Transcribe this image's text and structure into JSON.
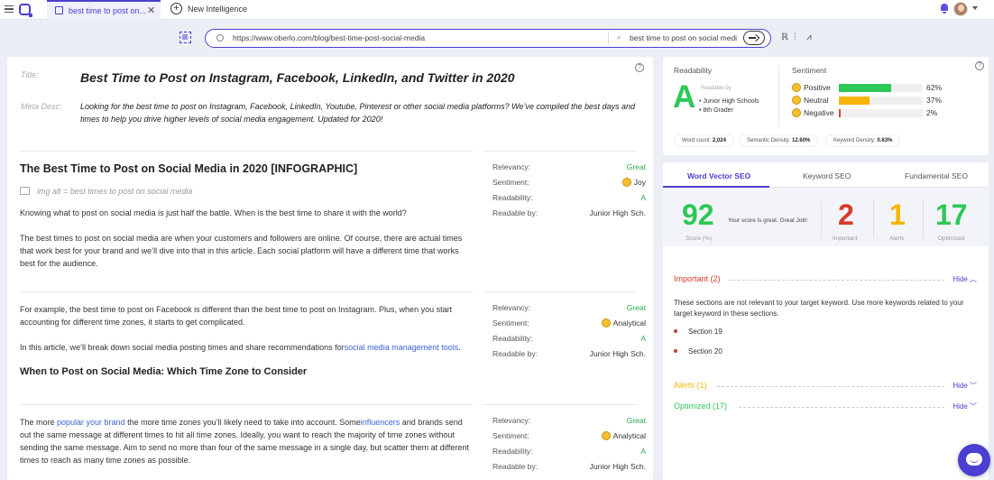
{
  "tabs": {
    "active_tab_label": "best time to post on...",
    "new_tab_label": "New Intelligence"
  },
  "urlbar": {
    "url": "https://www.oberlo.com/blog/best-time-post-social-media",
    "keyword": "best time to post on social medi"
  },
  "page": {
    "title_label": "Title:",
    "title": "Best Time to Post on Instagram, Facebook, LinkedIn, and Twitter in 2020",
    "meta_label": "Meta Desc:",
    "meta": "Looking for the best time to post on Instagram, Facebook, LinkedIn, Youtube, Pinterest or other social media platforms? We’ve compiled the best days and times to help you drive higher levels of social media engagement. Updated for 2020!"
  },
  "sections": [
    {
      "heading": "The Best Time to Post on Social Media in 2020 [INFOGRAPHIC]",
      "img_alt": "img alt = best times to post on social media",
      "p1": "Knowing what to post on social media is just half the battle. When is the best time to share it with the world?",
      "p2": "The best times to post on social media are when your customers and followers are online. Of course, there are actual times that work best for your brand and we’ll dive into that in this article. Each social platform will have a different time that works best for the audience.",
      "metrics": {
        "relevancy": "Great",
        "sentiment": "Joy",
        "readability": "A",
        "readable_by": "Junior High Sch."
      }
    },
    {
      "p1": "For example, the best time to post on Facebook is different than the best time to post on Instagram. Plus, when you start accounting for different time zones, it starts to get complicated.",
      "p2_pre": "In this article, we’ll break down social media posting times and share recommendations for",
      "p2_link": "social media management tools",
      "p2_post": ".",
      "heading": "When to Post on Social Media: Which Time Zone to Consider",
      "metrics": {
        "relevancy": "Great",
        "sentiment": "Analytical",
        "readability": "A",
        "readable_by": "Junior High Sch."
      }
    },
    {
      "p_a": "The more ",
      "link1": "popular your brand",
      "p_b": " the more time zones you’ll likely need to take into account. Some",
      "link2": "influencers",
      "p_c": " and brands send out the same message at different times to hit all time zones. Ideally, you want to reach the majority of time zones without sending the same message. Aim to send no more than four of the same message in a single day, but scatter them at different times to reach as many time zones as possible.",
      "metrics": {
        "relevancy": "Great",
        "sentiment": "Analytical",
        "readability": "A",
        "readable_by": "Junior High Sch."
      }
    }
  ],
  "metric_labels": {
    "relevancy": "Relevancy:",
    "sentiment": "Sentiment:",
    "readability": "Readability:",
    "readable_by": "Readable by:"
  },
  "panel": {
    "readability_label": "Readability",
    "grade": "A",
    "readable_by_label": "Readable by",
    "grades": [
      "Junior High Schools",
      "8th Grader"
    ],
    "sentiment_label": "Sentiment",
    "sentiments": [
      {
        "name": "Positive",
        "pct_label": "62%",
        "pct": 62,
        "color": "#2fc856"
      },
      {
        "name": "Neutral",
        "pct_label": "37%",
        "pct": 37,
        "color": "#f5b400"
      },
      {
        "name": "Negative",
        "pct_label": "2%",
        "pct": 2,
        "color": "#e53935"
      }
    ],
    "stats": {
      "word_count_label": "Word count:",
      "word_count": "2,024",
      "semantic_label": "Semantic Density:",
      "semantic": "12.60%",
      "keyword_label": "Keyword Density:",
      "keyword": "0.63%"
    }
  },
  "seo": {
    "tabs": [
      "Word Vector SEO",
      "Keyword SEO",
      "Fundamental SEO"
    ],
    "score": "92",
    "score_label": "Score (%)",
    "score_msg": "Your score is great. Great Job!",
    "important": "2",
    "important_label": "Important",
    "alerts": "1",
    "alerts_label": "Alerts",
    "optimized": "17",
    "optimized_label": "Optimized",
    "important_title": "Important (2)",
    "important_desc": "These sections are not relevant to your target keyword. Use more keywords related to your target keyword in these sections.",
    "items": [
      "Section 19",
      "Section 20"
    ],
    "alerts_title": "Alerts (1)",
    "optimized_title": "Optimized (17)",
    "hide": "Hide",
    "colors": {
      "score": "#2fc856",
      "important": "#d63a2a",
      "alerts": "#f5b400",
      "optimized": "#2fc856"
    }
  }
}
